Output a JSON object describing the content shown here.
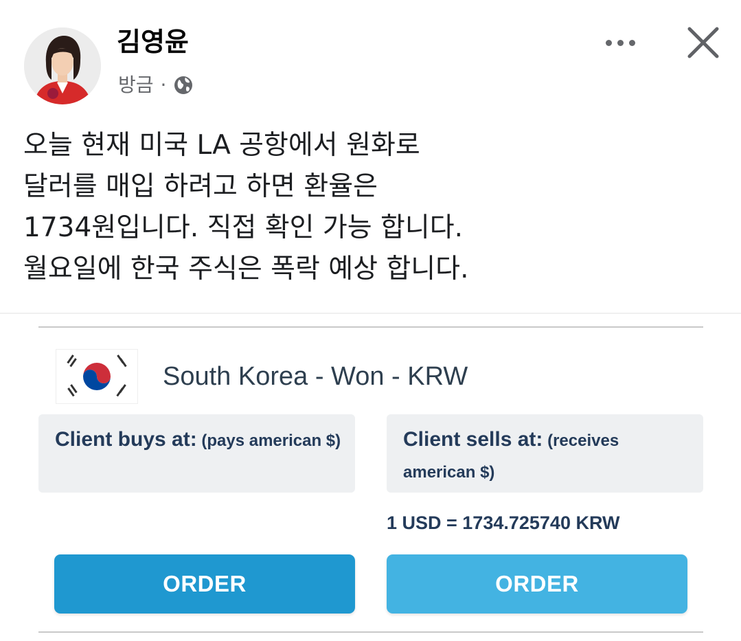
{
  "post": {
    "author": "김영윤",
    "timestamp": "방금",
    "separator": "·",
    "audience_icon": "globe-icon",
    "lines": [
      "오늘 현재 미국 LA 공항에서 원화로",
      "달러를 매입 하려고 하면 환율은",
      "1734원입니다. 직접 확인 가능 합니다.",
      "월요일에 한국 주식은 폭락 예상 합니다."
    ]
  },
  "actions": {
    "more_icon": "more-options-icon",
    "close_icon": "close-icon"
  },
  "exchange_card": {
    "flag_icon": "south-korea-flag-icon",
    "currency_title": "South Korea - Won - KRW",
    "buy_label_strong": "Client buys at:",
    "buy_label_rest": "(pays american $)",
    "sell_label_strong": "Client sells at:",
    "sell_label_rest": "(receives american $)",
    "sell_rate": "1 USD = 1734.725740 KRW",
    "buy_order_label": "ORDER",
    "sell_order_label": "ORDER"
  },
  "colors": {
    "order_left": "#1f98d0",
    "order_right": "#43b3e2",
    "label_text": "#243b5a",
    "box_bg": "#eef0f2"
  }
}
